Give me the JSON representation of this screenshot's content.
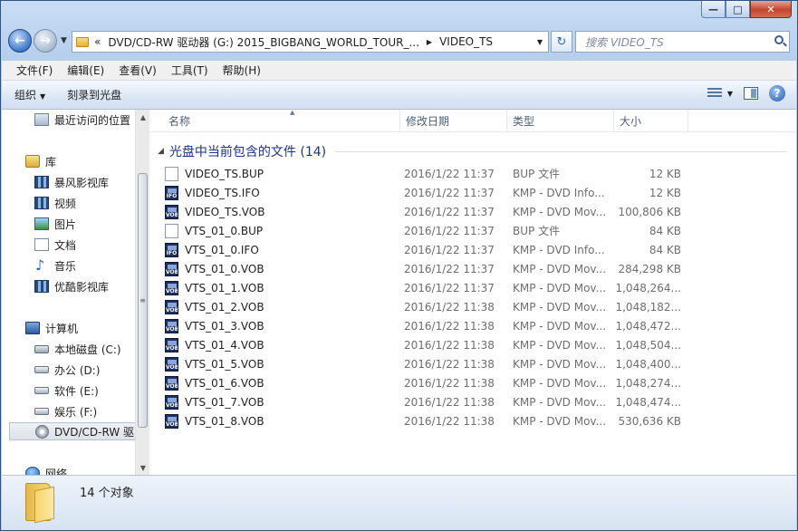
{
  "window": {
    "minimize": "—",
    "maximize": "□",
    "close": "✕"
  },
  "nav": {
    "back": "←",
    "forward": "→",
    "history_dropdown": "▼",
    "refresh": "↻"
  },
  "address": {
    "overflow": "«",
    "segments": [
      "DVD/CD-RW 驱动器 (G:) 2015_BIGBANG_WORLD_TOUR_...",
      "VIDEO_TS"
    ],
    "separator": "▶",
    "dropdown": "▼"
  },
  "search": {
    "placeholder": "搜索 VIDEO_TS"
  },
  "menubar": {
    "items": [
      "文件(F)",
      "编辑(E)",
      "查看(V)",
      "工具(T)",
      "帮助(H)"
    ]
  },
  "toolbar": {
    "organize": "组织",
    "organize_caret": "▼",
    "burn": "刻录到光盘",
    "view_caret": "▼",
    "help": "?"
  },
  "sidebar": {
    "items": [
      {
        "label": "最近访问的位置",
        "icon": "recent-places-icon"
      },
      {
        "label": "库",
        "icon": "library-icon"
      },
      {
        "label": "暴风影视库",
        "icon": "video-library-icon"
      },
      {
        "label": "视频",
        "icon": "videos-icon"
      },
      {
        "label": "图片",
        "icon": "pictures-icon"
      },
      {
        "label": "文档",
        "icon": "documents-icon"
      },
      {
        "label": "音乐",
        "icon": "music-icon"
      },
      {
        "label": "优酷影视库",
        "icon": "video-library-icon"
      },
      {
        "label": "计算机",
        "icon": "computer-icon"
      },
      {
        "label": "本地磁盘 (C:)",
        "icon": "system-drive-icon"
      },
      {
        "label": "办公 (D:)",
        "icon": "drive-icon"
      },
      {
        "label": "软件 (E:)",
        "icon": "drive-icon"
      },
      {
        "label": "娱乐 (F:)",
        "icon": "drive-icon"
      },
      {
        "label": "DVD/CD-RW 驱",
        "icon": "dvd-drive-icon"
      },
      {
        "label": "网络",
        "icon": "network-icon"
      }
    ],
    "scroll_up": "▲",
    "scroll_down": "▼",
    "thumb_grip": "≡"
  },
  "columns": {
    "name": "名称",
    "date": "修改日期",
    "type": "类型",
    "size": "大小",
    "sort_indicator": "▲"
  },
  "group": {
    "toggle": "◢",
    "title": "光盘中当前包含的文件 (14)"
  },
  "files": [
    {
      "name": "VIDEO_TS.BUP",
      "date": "2016/1/22 11:37",
      "type": "BUP 文件",
      "size": "12 KB",
      "icon": "blank"
    },
    {
      "name": "VIDEO_TS.IFO",
      "date": "2016/1/22 11:37",
      "type": "KMP - DVD Info...",
      "size": "12 KB",
      "icon": "IFO"
    },
    {
      "name": "VIDEO_TS.VOB",
      "date": "2016/1/22 11:37",
      "type": "KMP - DVD Mov...",
      "size": "100,806 KB",
      "icon": "VOB"
    },
    {
      "name": "VTS_01_0.BUP",
      "date": "2016/1/22 11:37",
      "type": "BUP 文件",
      "size": "84 KB",
      "icon": "blank"
    },
    {
      "name": "VTS_01_0.IFO",
      "date": "2016/1/22 11:37",
      "type": "KMP - DVD Info...",
      "size": "84 KB",
      "icon": "IFO"
    },
    {
      "name": "VTS_01_0.VOB",
      "date": "2016/1/22 11:37",
      "type": "KMP - DVD Mov...",
      "size": "284,298 KB",
      "icon": "VOB"
    },
    {
      "name": "VTS_01_1.VOB",
      "date": "2016/1/22 11:37",
      "type": "KMP - DVD Mov...",
      "size": "1,048,264...",
      "icon": "VOB"
    },
    {
      "name": "VTS_01_2.VOB",
      "date": "2016/1/22 11:38",
      "type": "KMP - DVD Mov...",
      "size": "1,048,182...",
      "icon": "VOB"
    },
    {
      "name": "VTS_01_3.VOB",
      "date": "2016/1/22 11:38",
      "type": "KMP - DVD Mov...",
      "size": "1,048,472...",
      "icon": "VOB"
    },
    {
      "name": "VTS_01_4.VOB",
      "date": "2016/1/22 11:38",
      "type": "KMP - DVD Mov...",
      "size": "1,048,504...",
      "icon": "VOB"
    },
    {
      "name": "VTS_01_5.VOB",
      "date": "2016/1/22 11:38",
      "type": "KMP - DVD Mov...",
      "size": "1,048,400...",
      "icon": "VOB"
    },
    {
      "name": "VTS_01_6.VOB",
      "date": "2016/1/22 11:38",
      "type": "KMP - DVD Mov...",
      "size": "1,048,274...",
      "icon": "VOB"
    },
    {
      "name": "VTS_01_7.VOB",
      "date": "2016/1/22 11:38",
      "type": "KMP - DVD Mov...",
      "size": "1,048,474...",
      "icon": "VOB"
    },
    {
      "name": "VTS_01_8.VOB",
      "date": "2016/1/22 11:38",
      "type": "KMP - DVD Mov...",
      "size": "530,636 KB",
      "icon": "VOB"
    }
  ],
  "details": {
    "count": "14 个对象"
  },
  "colors": {
    "group_title": "#1e3287",
    "frame": "#b9d1ef"
  }
}
